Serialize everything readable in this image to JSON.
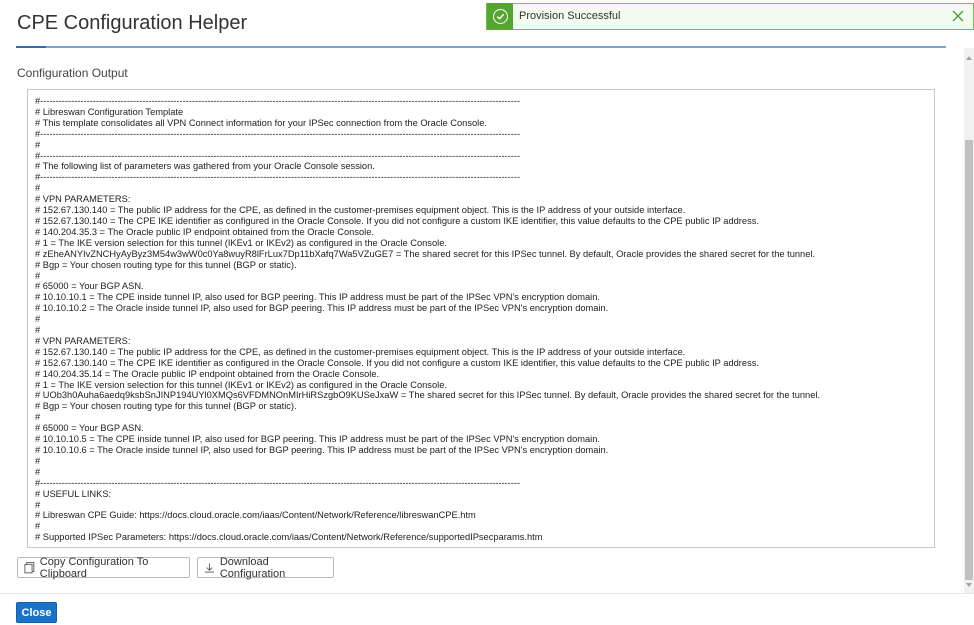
{
  "header": {
    "title": "CPE Configuration Helper"
  },
  "toast": {
    "message": "Provision Successful",
    "status_color": "#55a630"
  },
  "output": {
    "label": "Configuration Output",
    "text": "#-----------------------------------------------------------------------------------------------------------------------------------------------------------\n# Libreswan Configuration Template\n# This template consolidates all VPN Connect information for your IPSec connection from the Oracle Console.\n#-----------------------------------------------------------------------------------------------------------------------------------------------------------\n#\n#-----------------------------------------------------------------------------------------------------------------------------------------------------------\n# The following list of parameters was gathered from your Oracle Console session.\n#-----------------------------------------------------------------------------------------------------------------------------------------------------------\n#\n# VPN PARAMETERS:\n# 152.67.130.140 = The public IP address for the CPE, as defined in the customer-premises equipment object. This is the IP address of your outside interface.\n# 152.67.130.140 = The CPE IKE identifier as configured in the Oracle Console. If you did not configure a custom IKE identifier, this value defaults to the CPE public IP address.\n# 140.204.35.3 = The Oracle public IP endpoint obtained from the Oracle Console.\n# 1 = The IKE version selection for this tunnel (IKEv1 or IKEv2) as configured in the Oracle Console.\n# zEheANYIvZNCHyAyByz3M54w3wW0c0Ya8wuyR8lFrLux7Dp11bXafq7Wa5VZuGE7 = The shared secret for this IPSec tunnel. By default, Oracle provides the shared secret for the tunnel.\n# Bgp = Your chosen routing type for this tunnel (BGP or static).\n#\n# 65000 = Your BGP ASN.\n# 10.10.10.1 = The CPE inside tunnel IP, also used for BGP peering. This IP address must be part of the IPSec VPN's encryption domain.\n# 10.10.10.2 = The Oracle inside tunnel IP, also used for BGP peering. This IP address must be part of the IPSec VPN's encryption domain.\n#\n#\n# VPN PARAMETERS:\n# 152.67.130.140 = The public IP address for the CPE, as defined in the customer-premises equipment object. This is the IP address of your outside interface.\n# 152.67.130.140 = The CPE IKE identifier as configured in the Oracle Console. If you did not configure a custom IKE identifier, this value defaults to the CPE public IP address.\n# 140.204.35.14 = The Oracle public IP endpoint obtained from the Oracle Console.\n# 1 = The IKE version selection for this tunnel (IKEv1 or IKEv2) as configured in the Oracle Console.\n# UOb3h0Auha6aedq9ksbSnJINP194UYl0XMQs6VFDMNOnMIrHiRSzgbO9KUSeJxaW = The shared secret for this IPSec tunnel. By default, Oracle provides the shared secret for the tunnel.\n# Bgp = Your chosen routing type for this tunnel (BGP or static).\n#\n# 65000 = Your BGP ASN.\n# 10.10.10.5 = The CPE inside tunnel IP, also used for BGP peering. This IP address must be part of the IPSec VPN's encryption domain.\n# 10.10.10.6 = The Oracle inside tunnel IP, also used for BGP peering. This IP address must be part of the IPSec VPN's encryption domain.\n#\n#\n#-----------------------------------------------------------------------------------------------------------------------------------------------------------\n# USEFUL LINKS:\n#\n# Libreswan CPE Guide: https://docs.cloud.oracle.com/iaas/Content/Network/Reference/libreswanCPE.htm\n#\n# Supported IPSec Parameters: https://docs.cloud.oracle.com/iaas/Content/Network/Reference/supportedIPsecparams.htm"
  },
  "actions": {
    "copy_label": "Copy Configuration To Clipboard",
    "download_label": "Download Configuration"
  },
  "footer": {
    "close_label": "Close",
    "primary_color": "#1a73c9"
  }
}
